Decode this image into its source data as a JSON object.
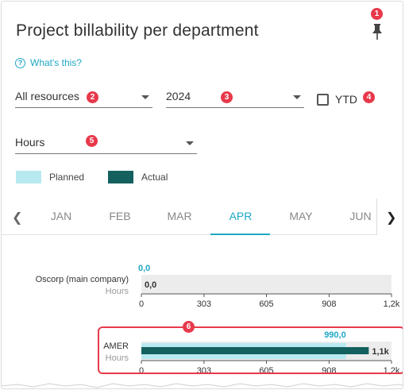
{
  "title": "Project billability per department",
  "help_link": "What's this?",
  "filters": {
    "resources": "All resources",
    "year": "2024",
    "ytd_label": "YTD",
    "unit": "Hours"
  },
  "badges": [
    "1",
    "2",
    "3",
    "4",
    "5",
    "6"
  ],
  "legend": {
    "planned": "Planned",
    "actual": "Actual"
  },
  "colors": {
    "planned": "#b7e9f0",
    "actual": "#13605e",
    "accent": "#1fa8c4",
    "badge": "#e8394b",
    "track": "#ececec"
  },
  "tabs": [
    "JAN",
    "FEB",
    "MAR",
    "APR",
    "MAY",
    "JUN"
  ],
  "active_tab": "APR",
  "chart_data": [
    {
      "type": "bar",
      "category": "Oscorp (main company)",
      "unit_label": "Hours",
      "series": [
        {
          "name": "Planned",
          "value": 0.0,
          "label": "0,0"
        },
        {
          "name": "Actual",
          "value": 0.0,
          "label": "0,0"
        }
      ],
      "xlim": [
        0,
        1210
      ],
      "ticks": [
        "0",
        "303",
        "605",
        "908",
        "1,2k"
      ],
      "tick_values": [
        0,
        303,
        605,
        908,
        1210
      ]
    },
    {
      "type": "bar",
      "category": "AMER",
      "unit_label": "Hours",
      "series": [
        {
          "name": "Planned",
          "value": 990.0,
          "label": "990,0"
        },
        {
          "name": "Actual",
          "value": 1100,
          "label": "1,1k"
        }
      ],
      "xlim": [
        0,
        1210
      ],
      "ticks": [
        "0",
        "303",
        "605",
        "908",
        "1,2k"
      ],
      "tick_values": [
        0,
        303,
        605,
        908,
        1210
      ]
    }
  ]
}
